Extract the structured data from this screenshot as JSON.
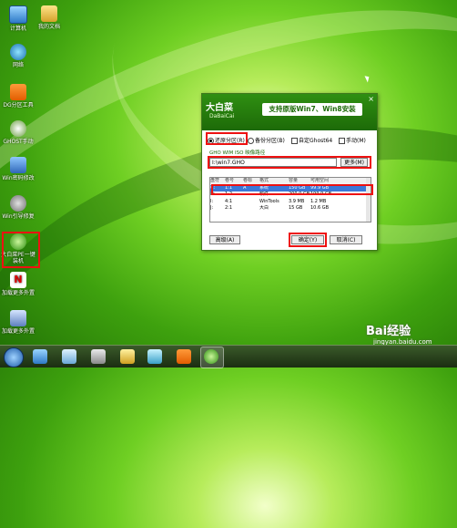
{
  "desktop": {
    "icons": [
      {
        "label": "计算机",
        "icon": "computer-icon"
      },
      {
        "label": "我的文档",
        "icon": "folder-icon"
      },
      {
        "label": "网络",
        "icon": "network-icon"
      },
      {
        "label": "DG分区工具",
        "icon": "diskgenius-icon"
      },
      {
        "label": "GHOST手动",
        "icon": "ghost-icon"
      },
      {
        "label": "Win密码修改",
        "icon": "windows-icon"
      },
      {
        "label": "Win引导修复",
        "icon": "gear-icon"
      },
      {
        "label": "大白菜PE一键装机",
        "icon": "dabaicai-icon"
      },
      {
        "label": "加载更多外置",
        "icon": "nt-icon"
      },
      {
        "label": "加载更多外置",
        "icon": "more-icon"
      }
    ]
  },
  "dialog": {
    "logo": "大白菜",
    "logo_sub": "DaBaiCai",
    "title": "支持原版Win7、Win8安装",
    "options": {
      "restore": "还原分区(R)",
      "backup": "备份分区(B)",
      "custom": "自定Ghost64",
      "manual": "手动(M)"
    },
    "path_label": "GHO WIM ISO 映像路径",
    "path_value": "I:\\win7.GHO",
    "more_button": "更多(M)",
    "table": {
      "headers": [
        "盘符",
        "卷号",
        "卷标",
        "格式",
        "容量",
        "可用空间"
      ],
      "rows": [
        [
          "C:",
          "1:1",
          "A",
          "系统",
          "150 GB",
          "99.9 GB"
        ],
        [
          "D:",
          "1:2",
          "",
          "软件",
          "200.0 GB",
          "199.9 GB"
        ],
        [
          "I:",
          "4:1",
          "",
          "WinTools",
          "3.9 MB",
          "1.2 MB"
        ],
        [
          "J:",
          "2:1",
          "",
          "大白",
          "15 GB",
          "10.6 GB"
        ]
      ]
    },
    "buttons": {
      "advanced": "高级(A)",
      "ok": "确定(Y)",
      "cancel": "取消(C)"
    }
  },
  "watermark": {
    "brand": "Bai经验",
    "url": "jingyan.baidu.com"
  },
  "colors": {
    "accent": "#1d6a08",
    "highlight": "#e11111",
    "selection": "#3b78d8"
  }
}
